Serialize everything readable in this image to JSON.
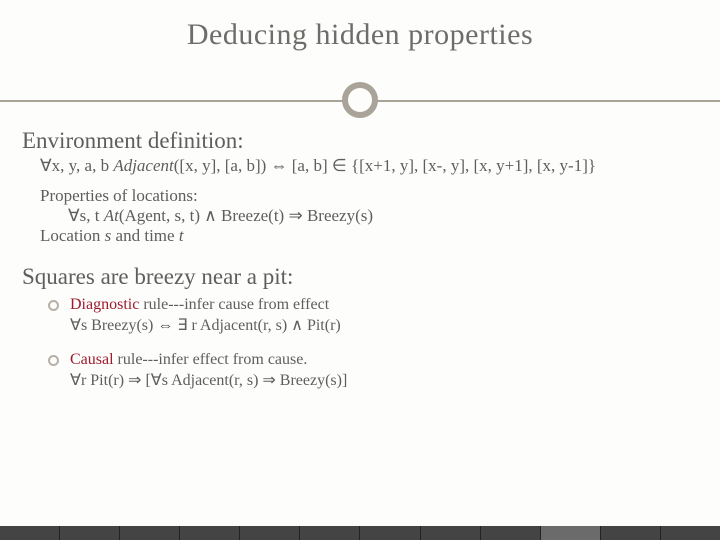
{
  "title": "Deducing hidden properties",
  "env_heading": "Environment definition:",
  "env_formula_prefix": "∀x, y, a, b ",
  "env_formula_adj": "Adjacent",
  "env_formula_rest": "([x, y], [a, b])  ⇔  [a, b] ∈ {[x+1, y], [x-, y], [x, y+1], [x, y-1]}",
  "props_label": "Properties of locations:",
  "props_formula_prefix": "∀s, t  ",
  "props_formula_at": "At",
  "props_formula_rest": "(Agent, s, t) ∧ Breeze(t) ⇒ Breezy(s)",
  "loc_line_a": "Location ",
  "loc_s": "s",
  "loc_line_b": " and time ",
  "loc_t": "t",
  "squares_heading": "Squares are breezy near a pit:",
  "diag_label": "Diagnostic",
  "diag_rest": " rule---infer cause from effect",
  "diag_formula": "∀s Breezy(s) ⇔ ∃ r Adjacent(r, s) ∧ Pit(r)",
  "causal_label": "Causal",
  "causal_rest": " rule---infer effect from cause.",
  "causal_formula": "∀r Pit(r) ⇒ [∀s Adjacent(r, s) ⇒ Breezy(s)]"
}
